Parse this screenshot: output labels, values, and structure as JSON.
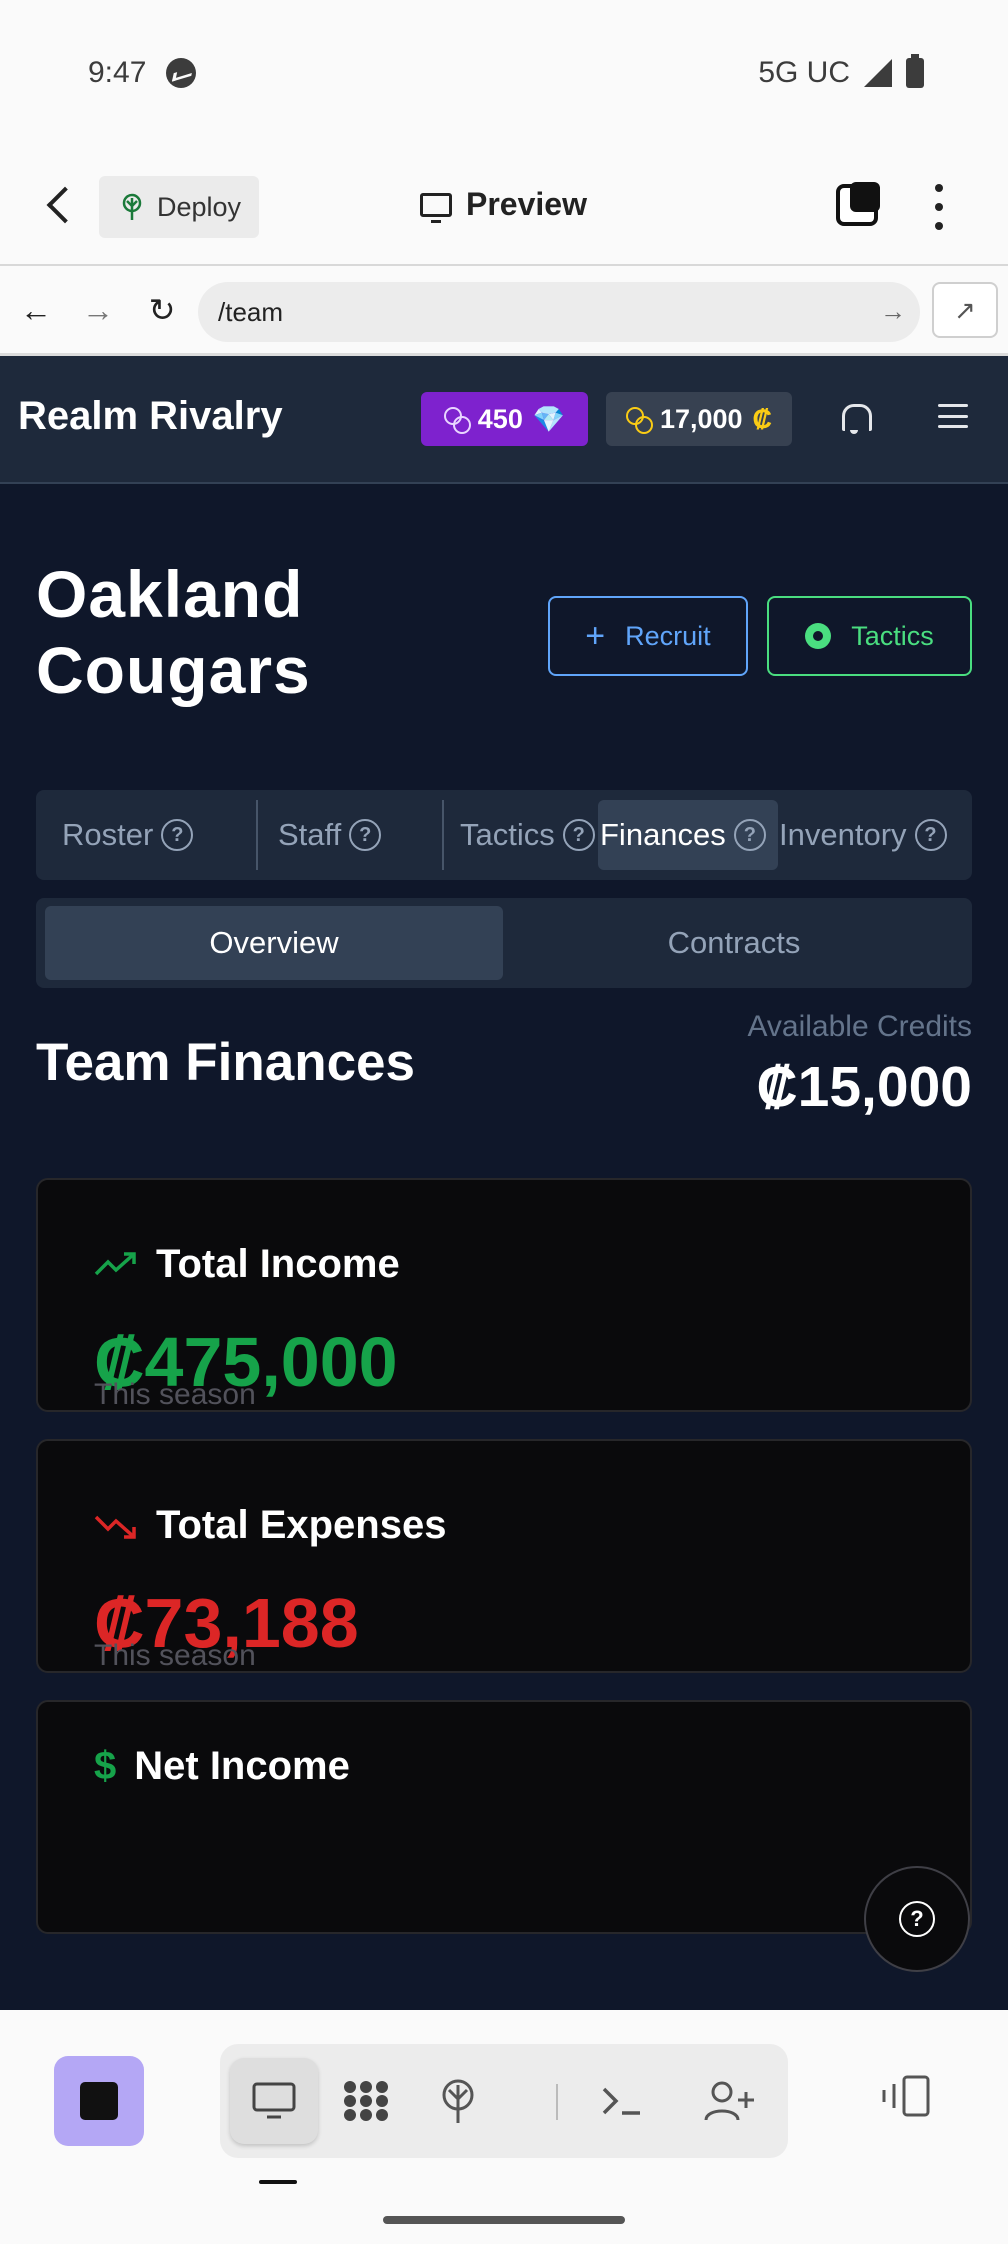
{
  "status_bar": {
    "time": "9:47",
    "network": "5G UC"
  },
  "app_bar": {
    "deploy_label": "Deploy",
    "preview_label": "Preview"
  },
  "browser": {
    "url": "/team"
  },
  "site": {
    "brand": "Realm Rivalry",
    "gems": "450",
    "coins": "17,000",
    "credit_symbol": "₡"
  },
  "team": {
    "name": "Oakland Cougars",
    "recruit_label": "Recruit",
    "tactics_label": "Tactics"
  },
  "main_tabs": [
    {
      "label": "Roster"
    },
    {
      "label": "Staff"
    },
    {
      "label": "Tactics"
    },
    {
      "label": "Finances"
    },
    {
      "label": "Inventory"
    }
  ],
  "sub_tabs": [
    {
      "label": "Overview"
    },
    {
      "label": "Contracts"
    }
  ],
  "finances": {
    "title": "Team Finances",
    "available_label": "Available Credits",
    "available_value": "₡15,000",
    "income": {
      "label": "Total Income",
      "amount": "₡475,000",
      "period": "This season",
      "color": "#16a34a"
    },
    "expenses": {
      "label": "Total Expenses",
      "amount": "₡73,188",
      "period": "This season",
      "color": "#dc2626"
    },
    "net": {
      "label": "Net Income"
    }
  },
  "icons": {
    "gem": "💎",
    "help": "?"
  }
}
